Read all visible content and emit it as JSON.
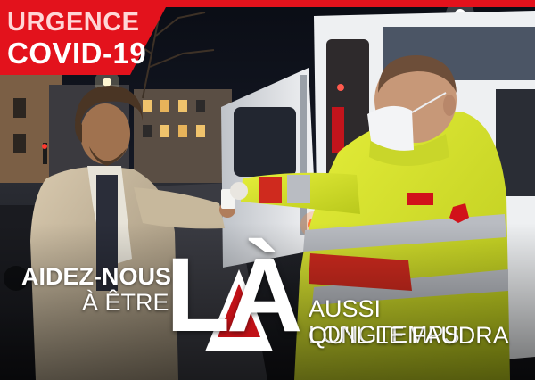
{
  "banner": {
    "line1": "URGENCE",
    "line2": "COVID-19"
  },
  "slogan": {
    "left_line1": "AIDEZ-NOUS",
    "left_line2": "À ÊTRE",
    "emphasis": "LÀ",
    "right_line1": "AUSSI LONGTEMPS",
    "right_line2": "QU'IL LE FAUDRA"
  },
  "colors": {
    "brand_red": "#e3121c",
    "jacket_yellow": "#d7e62a",
    "night_sky": "#101521"
  }
}
